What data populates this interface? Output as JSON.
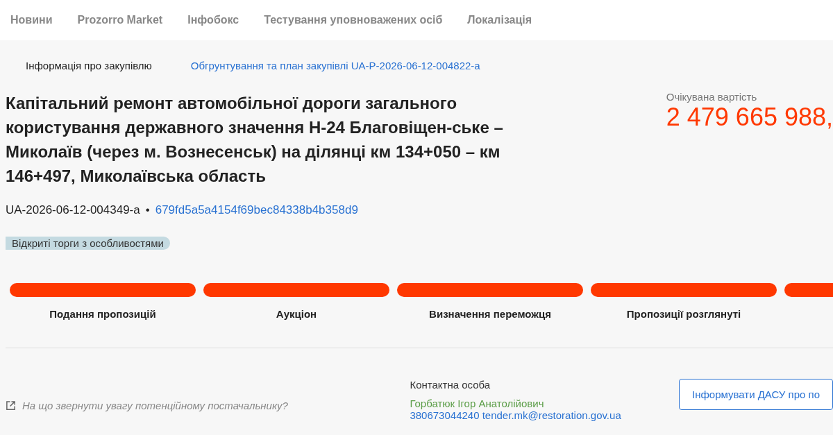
{
  "nav": [
    "Новини",
    "Prozorro Market",
    "Інфобокс",
    "Тестування уповноважених осіб",
    "Локалізація"
  ],
  "tabs": [
    {
      "label": "Інформація про закупівлю",
      "selected": true
    },
    {
      "label": "Обгрунтування та план закупівлі UA-P-2026-06-12-004822-a",
      "selected": false
    }
  ],
  "title": "Капітальний ремонт автомобільної дороги загального користування державного значення Н-24 Благовіщен-ське – Миколаїв (через м. Вознесенськ) на ділянці км 134+050 – км 146+497, Миколаївська область",
  "tender_id": "UA-2026-06-12-004349-a",
  "separator": "•",
  "hash": "679fd5a5a4154f69bec84338b4b358d9",
  "procedure_tag": "Відкриті торги з особливостями",
  "expected_value": {
    "label": "Очікувана вартість",
    "amount": "2 479 665 988,"
  },
  "stages": [
    {
      "label": "Подання пропозицій"
    },
    {
      "label": "Аукціон"
    },
    {
      "label": "Визначення переможця"
    },
    {
      "label": "Пропозиції розглянуті"
    }
  ],
  "supplier_hint": "На що звернути увагу потенційному постачальнику?",
  "contact": {
    "heading": "Контактна особа",
    "name": "Горбатюк Ігор Анатолійович",
    "phone": "380673044240",
    "email": "tender.mk@restoration.gov.ua"
  },
  "inform_button": "Інформувати ДАСУ про по"
}
